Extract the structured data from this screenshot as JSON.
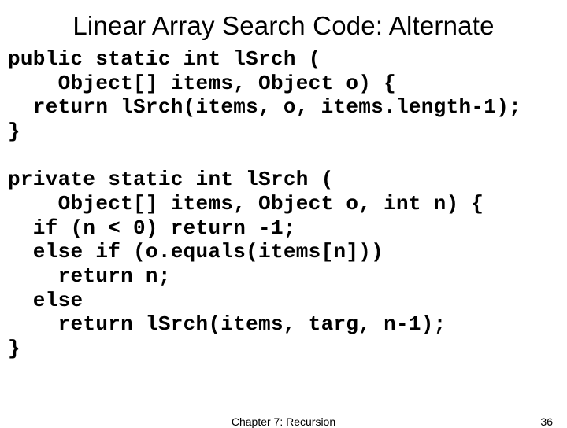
{
  "title": "Linear Array Search Code: Alternate",
  "code": "public static int lSrch (\n    Object[] items, Object o) {\n  return lSrch(items, o, items.length-1);\n}\n\nprivate static int lSrch (\n    Object[] items, Object o, int n) {\n  if (n < 0) return -1;\n  else if (o.equals(items[n]))\n    return n;\n  else\n    return lSrch(items, targ, n-1);\n}",
  "footer": {
    "center": "Chapter 7: Recursion",
    "page": "36"
  }
}
